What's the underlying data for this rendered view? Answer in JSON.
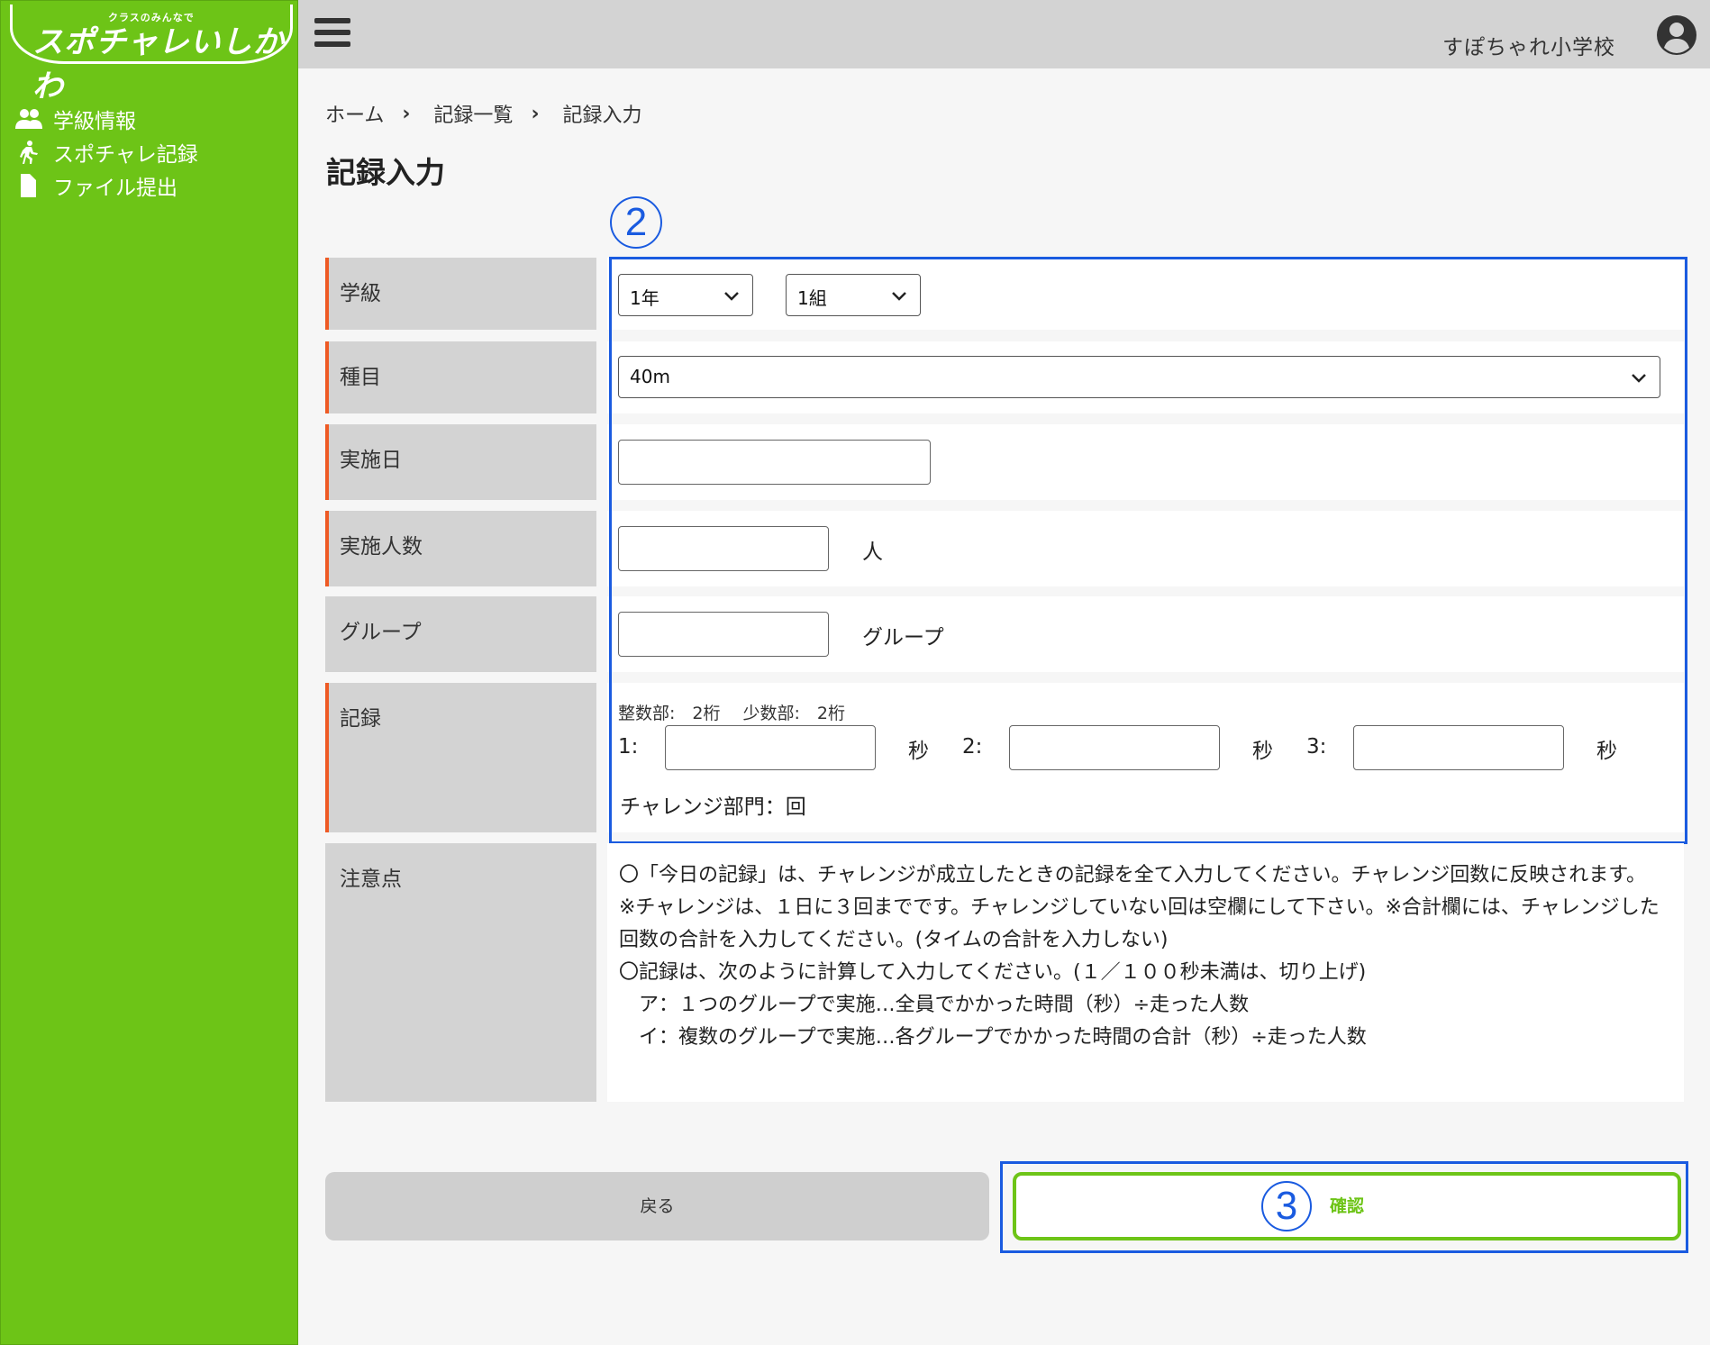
{
  "logo": {
    "sub": "クラスのみんなで",
    "main": "スポチャレいしかわ"
  },
  "sidebar": {
    "items": [
      {
        "label": "学級情報",
        "icon": "users-icon"
      },
      {
        "label": "スポチャレ記録",
        "icon": "runner-icon"
      },
      {
        "label": "ファイル提出",
        "icon": "file-icon"
      }
    ]
  },
  "header": {
    "school": "すぽちゃれ小学校"
  },
  "breadcrumb": [
    "ホーム",
    "記録一覧",
    "記録入力"
  ],
  "page_title": "記録入力",
  "annotations": {
    "step2": "2",
    "step3": "3"
  },
  "form": {
    "grade_label": "学級",
    "grade_value": "1年",
    "class_value": "1組",
    "event_label": "種目",
    "event_value": "40m",
    "date_label": "実施日",
    "count_label": "実施人数",
    "count_unit": "人",
    "group_label": "グループ",
    "group_unit": "グループ",
    "record_label": "記録",
    "record_hint": "整数部:　2桁　 少数部:　2桁",
    "record_1": "1:",
    "record_2": "2:",
    "record_3": "3:",
    "seconds": "秒",
    "challenge_text": "チャレンジ部門：回",
    "notes_label": "注意点"
  },
  "notes": [
    "〇「今日の記録」は、チャレンジが成立したときの記録を全て入力してください。チャレンジ回数に反映されます。",
    "※チャレンジは、１日に３回までです。チャレンジしていない回は空欄にして下さい。※合計欄には、チャレンジした回数の合計を入力してください。(タイムの合計を入力しない)",
    "〇記録は、次のように計算して入力してください。(１／１００秒未満は、切り上げ)",
    "　ア：１つのグループで実施…全員でかかった時間（秒）÷走った人数",
    "　イ：複数のグループで実施…各グループでかかった時間の合計（秒）÷走った人数"
  ],
  "buttons": {
    "back": "戻る",
    "confirm": "確認"
  },
  "colors": {
    "sidebar": "#6dc417",
    "accent_border": "#ee5a24",
    "highlight": "#1a5be0"
  }
}
